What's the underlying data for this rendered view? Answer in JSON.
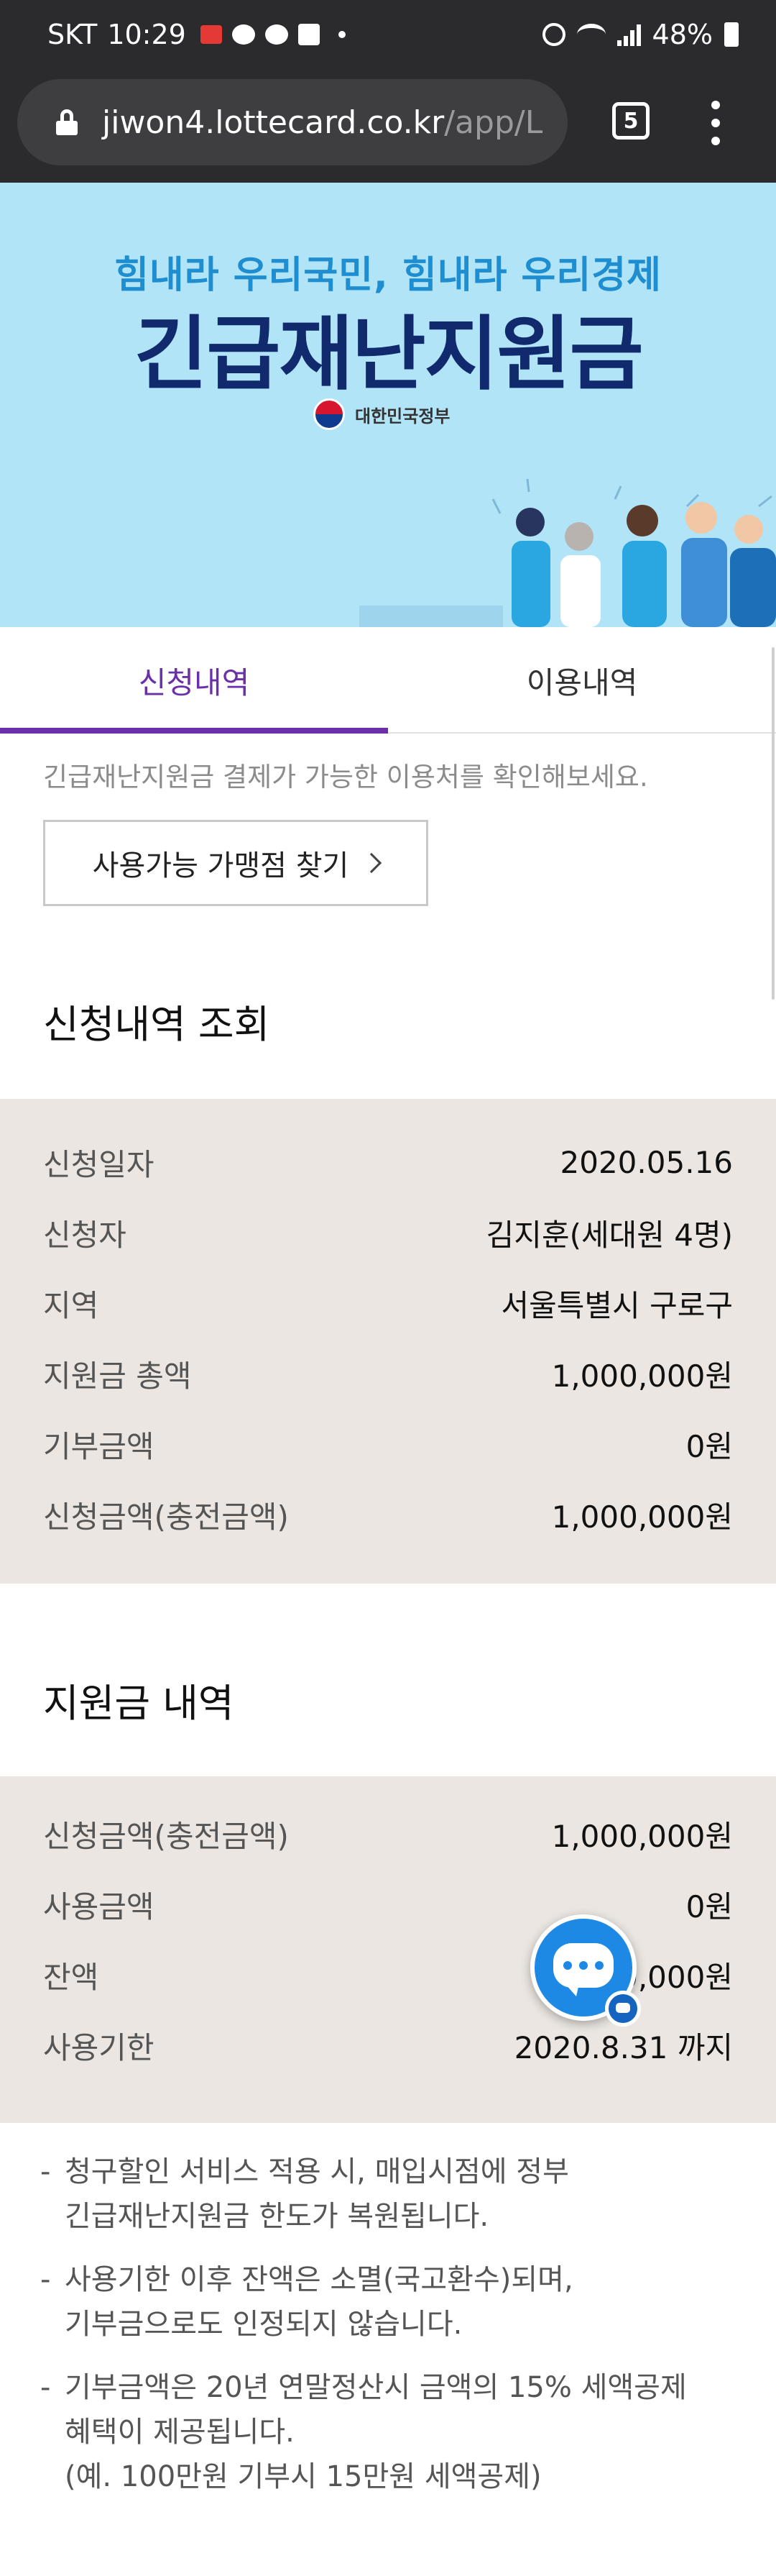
{
  "status_bar": {
    "carrier": "SKT",
    "time": "10:29",
    "battery": "48%"
  },
  "browser": {
    "url_host": "jiwon4.lottecard.co.kr",
    "url_path": "/app/L",
    "tab_count": "5"
  },
  "banner": {
    "subtitle": "힘내라 우리국민, 힘내라 우리경제",
    "title": "긴급재난지원금",
    "gov_label": "대한민국정부"
  },
  "tabs": [
    {
      "label": "신청내역",
      "active": true
    },
    {
      "label": "이용내역",
      "active": false
    }
  ],
  "info_text": "긴급재난지원금 결제가 가능한 이용처를 확인해보세요.",
  "store_button": "사용가능 가맹점 찾기",
  "application": {
    "title": "신청내역 조회",
    "rows": [
      {
        "label": "신청일자",
        "value": "2020.05.16"
      },
      {
        "label": "신청자",
        "value": "김지훈(세대원 4명)"
      },
      {
        "label": "지역",
        "value": "서울특별시 구로구"
      },
      {
        "label": "지원금 총액",
        "value": "1,000,000원"
      },
      {
        "label": "기부금액",
        "value": "0원"
      },
      {
        "label": "신청금액(충전금액)",
        "value": "1,000,000원"
      }
    ]
  },
  "support": {
    "title": "지원금 내역",
    "rows": [
      {
        "label": "신청금액(충전금액)",
        "value": "1,000,000원"
      },
      {
        "label": "사용금액",
        "value": "0원"
      },
      {
        "label": "잔액",
        "value": "1,000,000원"
      },
      {
        "label": "사용기한",
        "value": "2020.8.31 까지"
      }
    ]
  },
  "notes": [
    {
      "lines": [
        "청구할인 서비스 적용 시, 매입시점에 정부",
        "긴급재난지원금 한도가 복원됩니다."
      ]
    },
    {
      "lines": [
        "사용기한 이후 잔액은 소멸(국고환수)되며,",
        "기부금으로도 인정되지 않습니다."
      ]
    },
    {
      "lines": [
        "기부금액은 20년 연말정산시 금액의 15% 세액공제",
        "혜택이 제공됩니다.",
        "(예. 100만원 기부시 15만원 세액공제)"
      ]
    }
  ],
  "colors": {
    "accent": "#6a2fa9",
    "banner_bg": "#b2e4f8",
    "panel_bg": "#ebe6e1",
    "chat_fab": "#1e88e5"
  }
}
